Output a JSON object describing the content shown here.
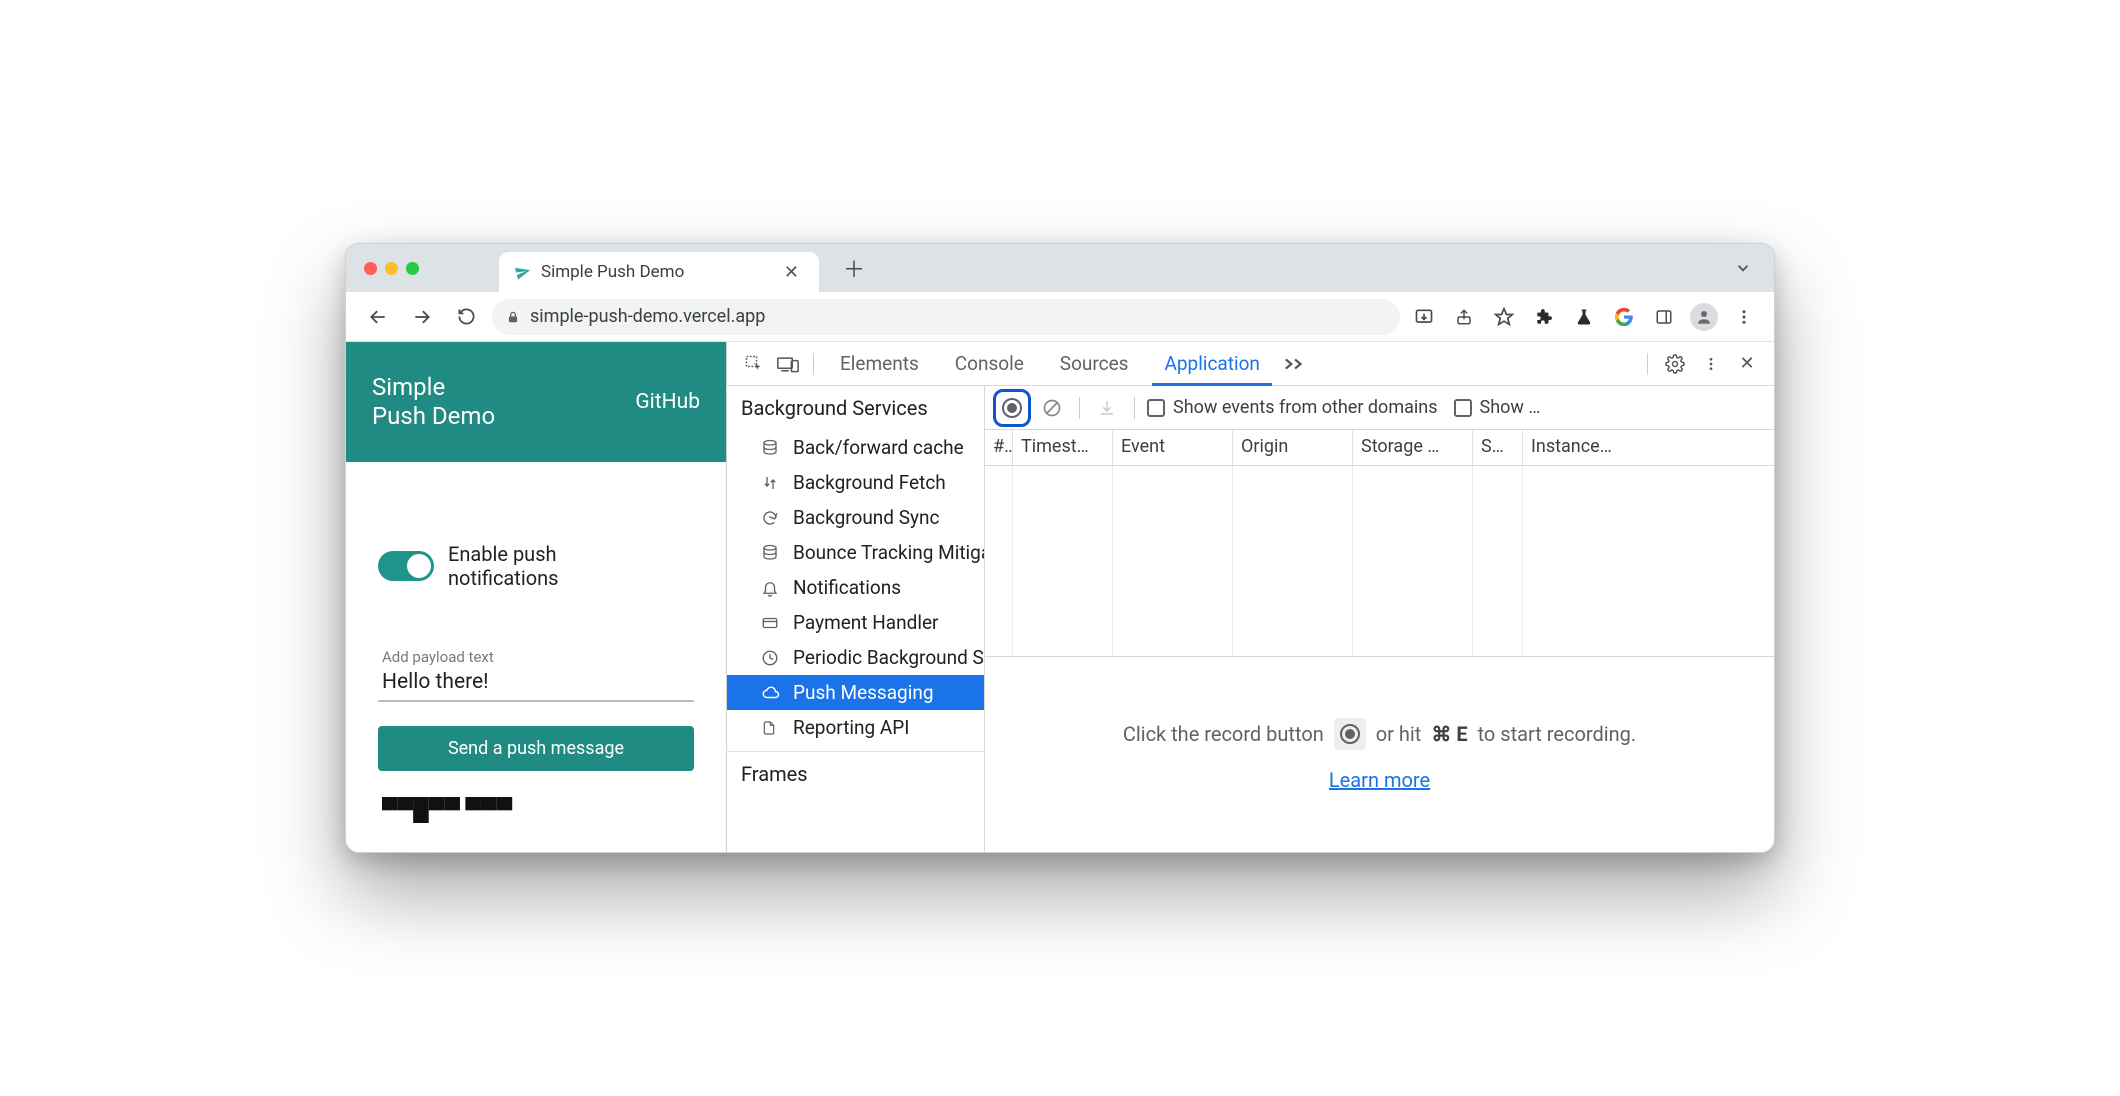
{
  "browser": {
    "tab_title": "Simple Push Demo",
    "url": "simple-push-demo.vercel.app"
  },
  "app": {
    "title_line1": "Simple",
    "title_line2": "Push Demo",
    "github": "GitHub",
    "toggle_label_line1": "Enable push",
    "toggle_label_line2": "notifications",
    "payload_placeholder": "Add payload text",
    "payload_value": "Hello there!",
    "send_label": "Send a push message"
  },
  "devtools": {
    "tabs": {
      "elements": "Elements",
      "console": "Console",
      "sources": "Sources",
      "application": "Application"
    },
    "sidebar": {
      "bg_header": "Background Services",
      "items": [
        "Back/forward cache",
        "Background Fetch",
        "Background Sync",
        "Bounce Tracking Mitigations",
        "Notifications",
        "Payment Handler",
        "Periodic Background Sync",
        "Push Messaging",
        "Reporting API"
      ],
      "frames_header": "Frames"
    },
    "toolbar": {
      "show_other": "Show events from other domains",
      "show_trunc": "Show …"
    },
    "columns": [
      "#",
      "Timest…",
      "Event",
      "Origin",
      "Storage …",
      "S…",
      "Instance…"
    ],
    "empty": {
      "prefix": "Click the record button",
      "suffix_a": "or hit",
      "shortcut": "⌘ E",
      "suffix_b": "to start recording.",
      "learn_more": "Learn more"
    }
  }
}
